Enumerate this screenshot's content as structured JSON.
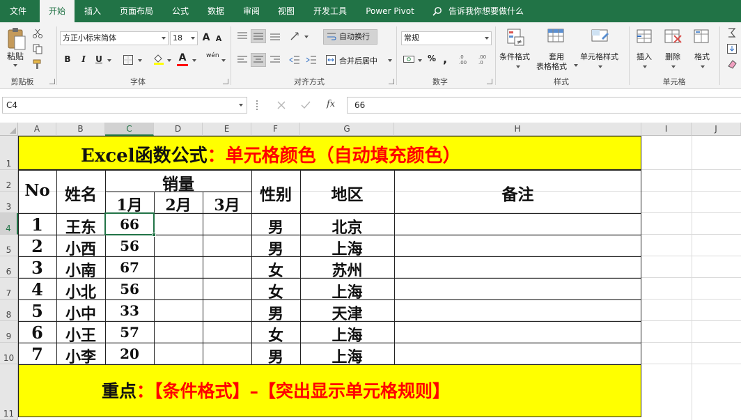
{
  "menu": {
    "tabs": [
      "文件",
      "开始",
      "插入",
      "页面布局",
      "公式",
      "数据",
      "审阅",
      "视图",
      "开发工具",
      "Power Pivot"
    ],
    "active_tab": "开始",
    "tell_me": "告诉我你想要做什么"
  },
  "ribbon": {
    "clipboard": {
      "paste": "粘贴",
      "label": "剪贴板"
    },
    "font": {
      "name": "方正小标宋简体",
      "size": "18",
      "bold": "B",
      "italic": "I",
      "underline": "U",
      "grow": "A",
      "shrink": "A",
      "font_color_letter": "A",
      "phonetic": "wén",
      "label": "字体"
    },
    "alignment": {
      "wrap_text": "自动换行",
      "merge_center": "合并后居中",
      "label": "对齐方式"
    },
    "number": {
      "format": "常规",
      "percent": "%",
      "comma": ",",
      "label": "数字"
    },
    "styles": {
      "conditional": "条件格式",
      "table_format_1": "套用",
      "table_format_2": "表格格式",
      "cell_styles": "单元格样式",
      "label": "样式"
    },
    "cells": {
      "insert": "插入",
      "delete": "删除",
      "format": "格式",
      "label": "单元格"
    }
  },
  "formula_bar": {
    "name_box": "C4",
    "fx": "fx",
    "value": "66"
  },
  "columns": [
    "A",
    "B",
    "C",
    "D",
    "E",
    "F",
    "G",
    "H",
    "I",
    "J"
  ],
  "selected_column": "C",
  "rows": [
    "1",
    "2",
    "3",
    "4",
    "5",
    "6",
    "7",
    "8",
    "9",
    "10",
    "11"
  ],
  "selected_row": "4",
  "sheet": {
    "title_black": "Excel函数公式",
    "title_colon": "：",
    "title_red": "单元格颜色（自动填充颜色）",
    "headers": {
      "no": "No",
      "name": "姓名",
      "sales": "销量",
      "m1": "1月",
      "m2": "2月",
      "m3": "3月",
      "gender": "性别",
      "region": "地区",
      "remark": "备注"
    },
    "records": [
      {
        "no": "1",
        "name": "王东",
        "m1": "66",
        "gender": "男",
        "region": "北京"
      },
      {
        "no": "2",
        "name": "小西",
        "m1": "56",
        "gender": "男",
        "region": "上海"
      },
      {
        "no": "3",
        "name": "小南",
        "m1": "67",
        "gender": "女",
        "region": "苏州"
      },
      {
        "no": "4",
        "name": "小北",
        "m1": "56",
        "gender": "女",
        "region": "上海"
      },
      {
        "no": "5",
        "name": "小中",
        "m1": "33",
        "gender": "男",
        "region": "天津"
      },
      {
        "no": "6",
        "name": "小王",
        "m1": "57",
        "gender": "女",
        "region": "上海"
      },
      {
        "no": "7",
        "name": "小李",
        "m1": "20",
        "gender": "男",
        "region": "上海"
      }
    ],
    "footer_black": "重点",
    "footer_colon": "：",
    "footer_red": "【条件格式】–【突出显示单元格规则】"
  },
  "colors": {
    "excel_green": "#217346",
    "highlight_yellow": "#ffff00",
    "title_red": "#ff0000"
  }
}
